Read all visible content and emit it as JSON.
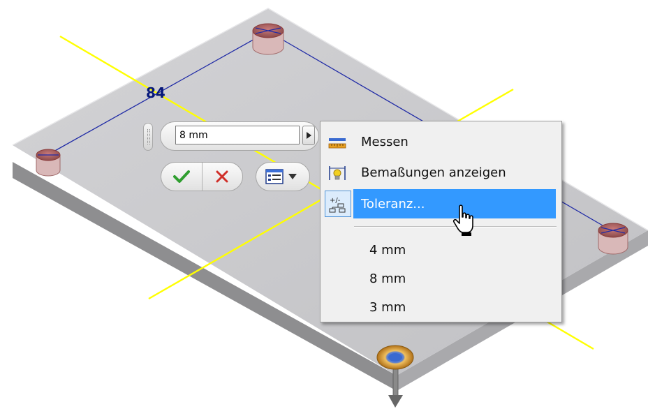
{
  "dimension": {
    "label": "84",
    "input_value": "8 mm"
  },
  "toolbar": {
    "ok_icon": "checkmark-icon",
    "cancel_icon": "x-icon",
    "options_icon": "list-options-icon",
    "dropdown_icon": "chevron-down-icon"
  },
  "menu": {
    "items": [
      {
        "label": "Messen",
        "icon": "ruler-icon"
      },
      {
        "label": "Bemaßungen anzeigen",
        "icon": "show-dimensions-icon"
      },
      {
        "label": "Toleranz...",
        "icon": "tolerance-icon",
        "highlighted": true
      }
    ],
    "recent_values": [
      "4 mm",
      "8 mm",
      "3 mm"
    ]
  },
  "colors": {
    "highlight": "#3399ff",
    "dimension_text": "#06187a",
    "sketch_line": "#ffff00",
    "plate_top": "#c9c9cc",
    "ok_green": "#2f9e2f",
    "cancel_red": "#d0302a"
  }
}
